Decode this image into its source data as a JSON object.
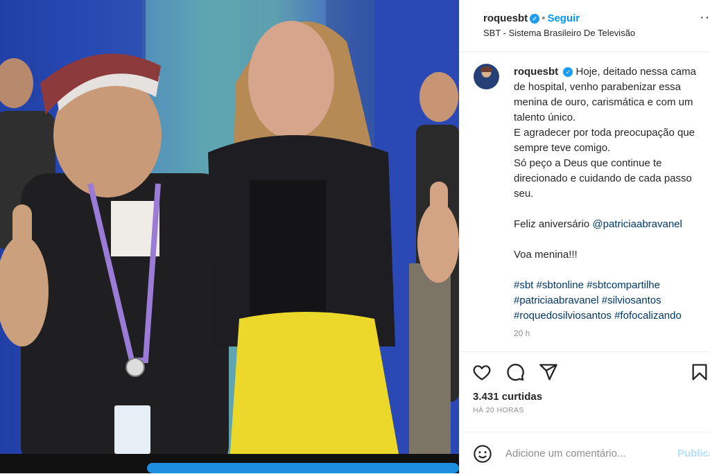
{
  "post_header": {
    "username": "roquesbt",
    "separator": "•",
    "follow_label": "Seguir",
    "location": "SBT - Sistema Brasileiro De Televisão",
    "more_icon": "ellipsis-icon"
  },
  "caption": {
    "username": "roquesbt",
    "lines": [
      "Hoje, deitado nessa cama de hospital, venho parabenizar essa menina de ouro, carismática e com um talento único.",
      "E agradecer por toda preocupação que sempre teve comigo.",
      "Só peço a Deus que continue te direcionado e cuidando de cada passo seu."
    ],
    "birthday_prefix": "Feliz aniversário",
    "mention": "@patriciaabravanel",
    "voa": "Voa menina!!!",
    "hashtags_line1": "#sbt #sbtonline #sbtcompartilhe",
    "hashtags_line2": "#patriciaabravanel #silviosantos",
    "hashtags_line3": "#roquedosilviosantos #fofocalizando",
    "time": "20 h"
  },
  "actions": {
    "icons": [
      "heart-icon",
      "comment-icon",
      "share-icon",
      "bookmark-icon"
    ],
    "likes": "3.431 curtidas",
    "posted_ago": "HÁ 20 HORAS"
  },
  "comment_box": {
    "placeholder": "Adicione um comentário...",
    "post_label": "Publicar"
  },
  "colors": {
    "link_blue": "#0095f6",
    "hashtag": "#00376b",
    "text": "#262626",
    "muted": "#8e8e8e"
  }
}
